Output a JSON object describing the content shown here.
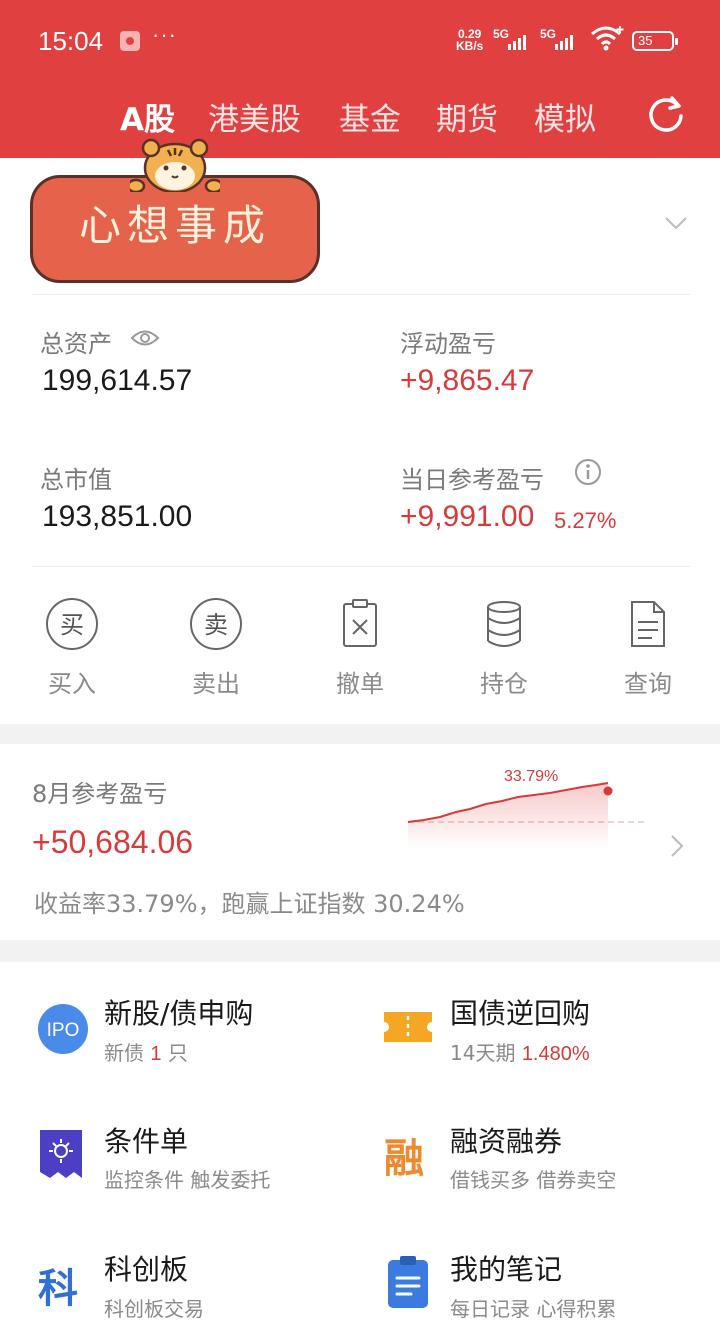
{
  "status_bar": {
    "time": "15:04",
    "dots": "···",
    "net_speed_value": "0.29",
    "net_speed_unit": "KB/s",
    "signal1_label": "5G",
    "signal2_label": "5G",
    "battery": "35"
  },
  "nav": {
    "tabs": [
      {
        "label": "A股",
        "active": true
      },
      {
        "label": "港美股",
        "active": false
      },
      {
        "label": "基金",
        "active": false
      },
      {
        "label": "期货",
        "active": false
      },
      {
        "label": "模拟",
        "active": false
      }
    ],
    "refresh_icon": "refresh-icon"
  },
  "banner": {
    "text": "心想事成",
    "decoration": "tiger-mascot"
  },
  "account": {
    "total_assets_label": "总资产",
    "total_assets_value": "199,614.57",
    "floating_pnl_label": "浮动盈亏",
    "floating_pnl_value": "+9,865.47",
    "market_value_label": "总市值",
    "market_value_value": "193,851.00",
    "daily_pnl_label": "当日参考盈亏",
    "daily_pnl_value": "+9,991.00",
    "daily_pnl_pct": "5.27%"
  },
  "actions": [
    {
      "label": "买入",
      "icon": "buy-icon",
      "glyph": "买"
    },
    {
      "label": "卖出",
      "icon": "sell-icon",
      "glyph": "卖"
    },
    {
      "label": "撤单",
      "icon": "cancel-order-icon"
    },
    {
      "label": "持仓",
      "icon": "position-icon"
    },
    {
      "label": "查询",
      "icon": "query-icon"
    }
  ],
  "monthly": {
    "title": "8月参考盈亏",
    "value": "+50,684.06",
    "summary": "收益率33.79%，跑赢上证指数 30.24%",
    "chart_peak_label": "33.79%"
  },
  "services": [
    {
      "title": "新股/债申购",
      "sub_prefix": "新债 ",
      "sub_highlight": "1",
      "sub_suffix": " 只",
      "icon": "ipo-icon",
      "icon_text": "IPO"
    },
    {
      "title": "国债逆回购",
      "sub_prefix": "14天期 ",
      "sub_highlight": "1.480%",
      "sub_suffix": "",
      "icon": "ticket-icon"
    },
    {
      "title": "条件单",
      "sub_prefix": "监控条件 触发委托",
      "sub_highlight": "",
      "sub_suffix": "",
      "icon": "condition-order-icon"
    },
    {
      "title": "融资融券",
      "sub_prefix": "借钱买多 借券卖空",
      "sub_highlight": "",
      "sub_suffix": "",
      "icon": "margin-icon",
      "icon_text": "融"
    },
    {
      "title": "科创板",
      "sub_prefix": "科创板交易",
      "sub_highlight": "",
      "sub_suffix": "",
      "icon": "star-market-icon",
      "icon_text": "科"
    },
    {
      "title": "我的笔记",
      "sub_prefix": "每日记录 心得积累",
      "sub_highlight": "",
      "sub_suffix": "",
      "icon": "notes-icon"
    }
  ],
  "colors": {
    "brand_red": "#e04040",
    "profit_red": "#d83a3a",
    "ipo_blue": "#4a8ae8",
    "ticket_orange": "#f5a623",
    "condition_purple": "#4b3fc4",
    "margin_orange": "#f0892e",
    "star_blue": "#2f6fd6",
    "notes_blue": "#3b7be0"
  }
}
